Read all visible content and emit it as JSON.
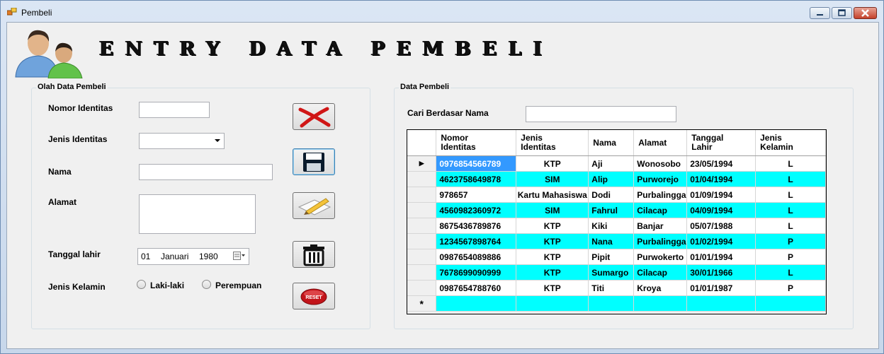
{
  "window": {
    "title": "Pembeli"
  },
  "header": {
    "title": "ENTRY DATA PEMBELI"
  },
  "form_group": {
    "title": "Olah Data Pembeli",
    "nomor_label": "Nomor Identitas",
    "jenis_label": "Jenis Identitas",
    "nama_label": "Nama",
    "alamat_label": "Alamat",
    "tanggal_label": "Tanggal lahir",
    "kelamin_label": "Jenis Kelamin",
    "nomor_value": "",
    "jenis_value": "",
    "nama_value": "",
    "alamat_value": "",
    "date": {
      "day": "01",
      "month": "Januari",
      "year": "1980"
    },
    "radio_male": "Laki-laki",
    "radio_female": "Perempuan",
    "reset_text": "RESET"
  },
  "data_group": {
    "title": "Data Pembeli",
    "search_label": "Cari Berdasar Nama",
    "search_value": ""
  },
  "table": {
    "headers": [
      "Nomor\nIdentitas",
      "Jenis\nIdentitas",
      "Nama",
      "Alamat",
      "Tanggal\nLahir",
      "Jenis\nKelamin"
    ],
    "rows": [
      [
        "0976854566789",
        "KTP",
        "Aji",
        "Wonosobo",
        "23/05/1994",
        "L"
      ],
      [
        "4623758649878",
        "SIM",
        "Alip",
        "Purworejo",
        "01/04/1994",
        "L"
      ],
      [
        "978657",
        "Kartu Mahasiswa",
        "Dodi",
        "Purbalingga",
        "01/09/1994",
        "L"
      ],
      [
        "4560982360972",
        "SIM",
        "Fahrul",
        "Cilacap",
        "04/09/1994",
        "L"
      ],
      [
        "8675436789876",
        "KTP",
        "Kiki",
        "Banjar",
        "05/07/1988",
        "L"
      ],
      [
        "1234567898764",
        "KTP",
        "Nana",
        "Purbalingga",
        "01/02/1994",
        "P"
      ],
      [
        "0987654089886",
        "KTP",
        "Pipit",
        "Purwokerto",
        "01/01/1994",
        "P"
      ],
      [
        "7678699090999",
        "KTP",
        "Sumargo",
        "Cilacap",
        "30/01/1966",
        "L"
      ],
      [
        "0987654788760",
        "KTP",
        "Titi",
        "Kroya",
        "01/01/1987",
        "P"
      ]
    ],
    "selected_row_glyph": "▶",
    "new_row_glyph": "*"
  },
  "colors": {
    "alt_row": "#00ffff",
    "selection": "#3399ff"
  }
}
